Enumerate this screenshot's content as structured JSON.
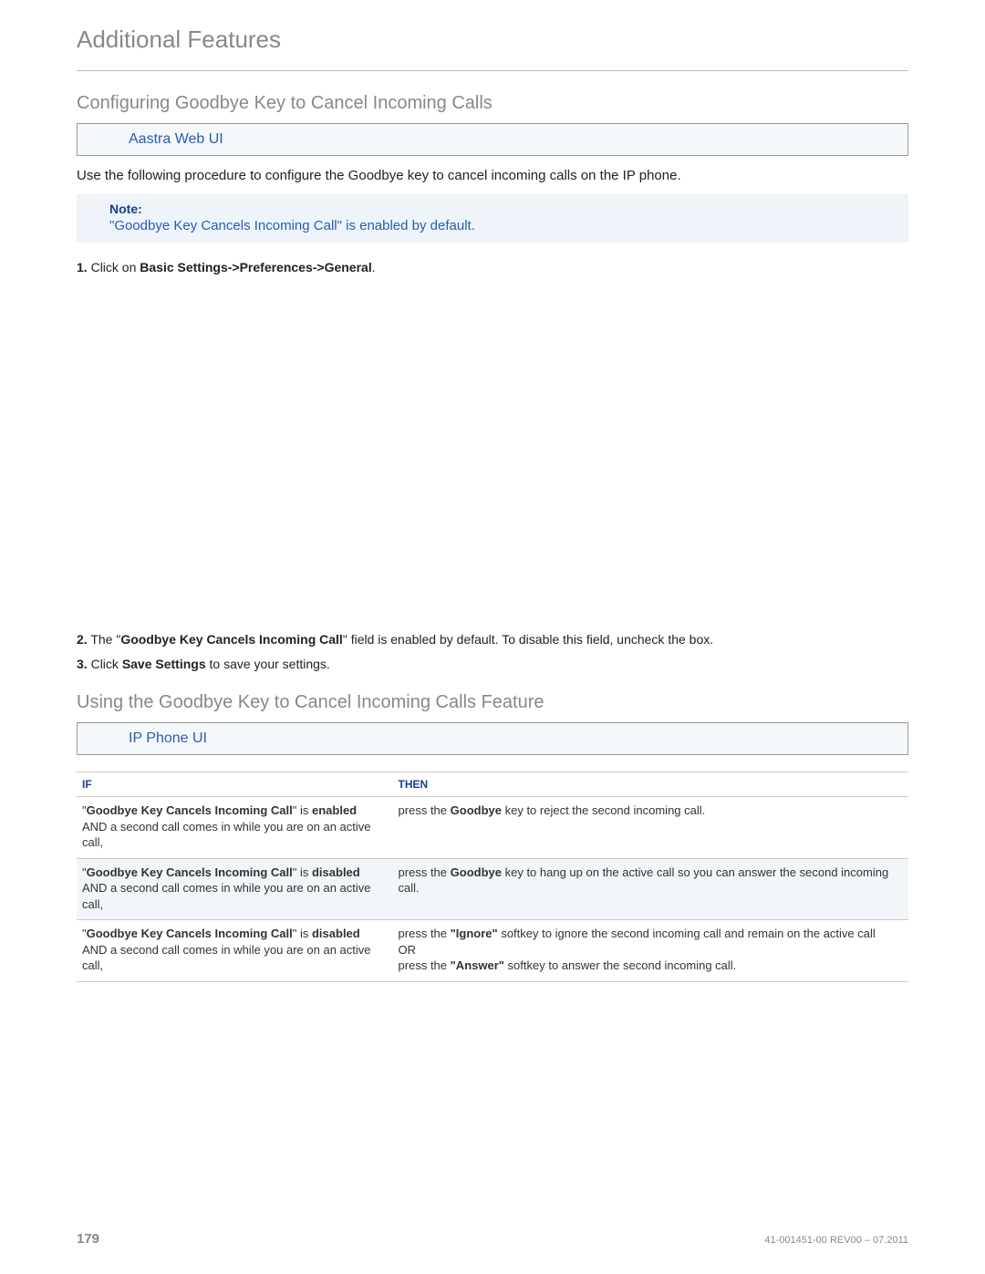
{
  "chapter_title": "Additional Features",
  "section1": {
    "heading": "Configuring Goodbye Key to Cancel Incoming Calls",
    "ui_box": "Aastra Web UI",
    "intro": "Use the following procedure to configure the Goodbye key to cancel incoming calls on the IP phone.",
    "note": {
      "label": "Note:",
      "text": "\"Goodbye Key Cancels Incoming Call\" is enabled by default."
    },
    "steps": {
      "s1": {
        "num": "1.",
        "pre": "Click on ",
        "bold": "Basic Settings->Preferences->General",
        "post": "."
      },
      "s2": {
        "num": "2.",
        "pre": "The \"",
        "bold": "Goodbye Key Cancels Incoming Call",
        "post": "\" field is enabled by default. To disable this field, uncheck the box."
      },
      "s3": {
        "num": "3.",
        "pre": "Click ",
        "bold": "Save Settings",
        "post": " to save your settings."
      }
    }
  },
  "section2": {
    "heading": "Using the Goodbye Key to Cancel Incoming Calls Feature",
    "ui_box": "IP Phone UI",
    "table": {
      "head_if": "IF",
      "head_then": "THEN",
      "rows": [
        {
          "if_pre": "\"",
          "if_bold": "Goodbye Key Cancels Incoming Call",
          "if_mid": "\" is ",
          "if_state": "enabled",
          "if_rest": " AND a second call comes in while you are on an active call,",
          "then_pre": "press the ",
          "then_bold": "Goodbye",
          "then_post": " key to reject the second incoming call."
        },
        {
          "if_pre": "\"",
          "if_bold": "Goodbye Key Cancels Incoming Call",
          "if_mid": "\" is ",
          "if_state": "disabled",
          "if_rest": " AND a second call comes in while you are on an active call,",
          "then_pre": "press the ",
          "then_bold": "Goodbye",
          "then_post": " key to hang up on the active call so you can answer the second incoming call."
        },
        {
          "if_pre": "\"",
          "if_bold": "Goodbye Key Cancels Incoming Call",
          "if_mid": "\" is ",
          "if_state": "disabled",
          "if_rest": " AND a second call comes in while you are on an active call,",
          "then_a_pre": "press the ",
          "then_a_bold": "\"Ignore\"",
          "then_a_post": " softkey to ignore the second incoming call and remain on the active call",
          "then_or": "OR",
          "then_b_pre": "press the ",
          "then_b_bold": "\"Answer\"",
          "then_b_post": " softkey to answer the second incoming call."
        }
      ]
    }
  },
  "footer": {
    "page_num": "179",
    "doc_id": "41-001451-00 REV00 – 07.2011"
  }
}
